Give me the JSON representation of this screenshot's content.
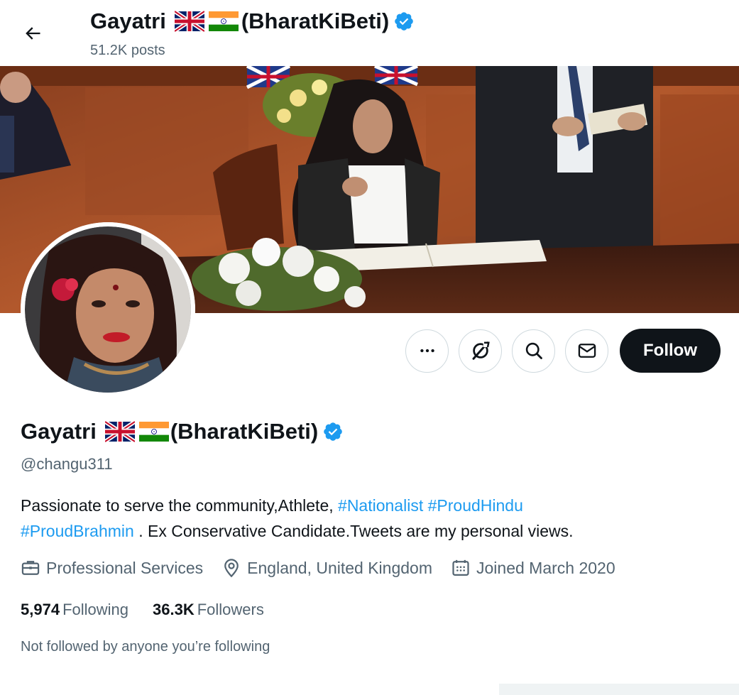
{
  "header": {
    "name": "Gayatri",
    "suffix": "(BharatKiBeti)",
    "posts": "51.2K posts"
  },
  "profile": {
    "name": "Gayatri",
    "suffix": "(BharatKiBeti)",
    "handle": "@changu311",
    "bio": {
      "text1": "Passionate to serve the community,Athlete, ",
      "tag1": "#Nationalist",
      "tag2": "#ProudHindu",
      "tag3": "#ProudBrahmin",
      "text2": " . Ex Conservative Candidate.Tweets are my personal views."
    },
    "category": "Professional Services",
    "location": "England, United Kingdom",
    "joined": "Joined March 2020",
    "following_count": "5,974",
    "following_label": "Following",
    "followers_count": "36.3K",
    "followers_label": "Followers",
    "not_followed": "Not followed by anyone you’re following"
  },
  "actions": {
    "follow_label": "Follow",
    "icons": [
      "more-icon",
      "grok-icon",
      "search-icon",
      "mail-icon"
    ]
  },
  "colors": {
    "accent": "#1d9bf0",
    "text": "#0f1419",
    "secondary": "#536471"
  }
}
